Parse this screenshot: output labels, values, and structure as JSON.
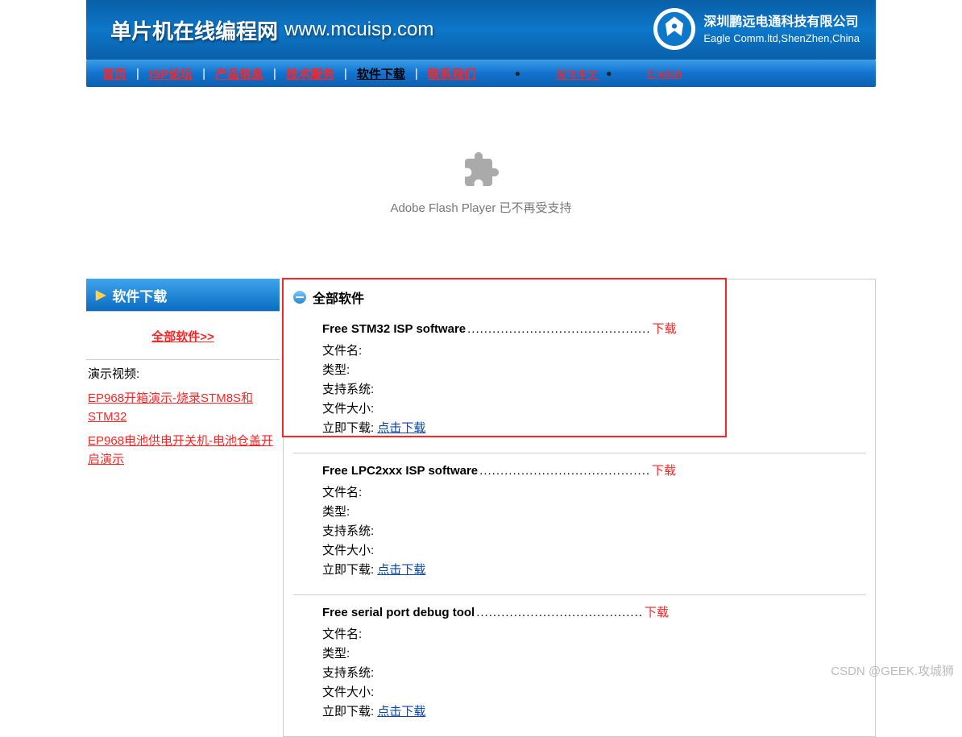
{
  "header": {
    "title_cn": "单片机在线编程网",
    "title_url": "www.mcuisp.com",
    "company_cn": "深圳鹏远电通科技有限公司",
    "company_en": "Eagle Comm.ltd,ShenZhen,China"
  },
  "nav": {
    "items": [
      {
        "label": "首页",
        "active": false
      },
      {
        "label": "ISP论坛",
        "active": false
      },
      {
        "label": "产品信息",
        "active": false
      },
      {
        "label": "技术服务",
        "active": false
      },
      {
        "label": "软件下载",
        "active": true
      },
      {
        "label": "联系我们",
        "active": false
      }
    ],
    "sep": "|",
    "lang_cn": "简体中文",
    "lang_en": "English",
    "lang_bullet": "●"
  },
  "flash": {
    "text": "Adobe Flash Player 已不再受支持"
  },
  "sidebar": {
    "header": "软件下载",
    "all_link": "全部软件>>",
    "demo_label": "演示视频:",
    "demo_links": [
      "EP968开箱演示-烧录STM8S和STM32",
      "EP968电池供电开关机-电池仓盖开启演示"
    ]
  },
  "main": {
    "section_title": "全部软件",
    "field_labels": {
      "filename": "文件名:",
      "type": "类型:",
      "os": "支持系统:",
      "size": "文件大小:",
      "download_now": "立即下载:"
    },
    "download_link_text": "点击下载",
    "badge_text": "下载",
    "software": [
      {
        "title": "Free STM32 ISP software",
        "dots": "............................................"
      },
      {
        "title": "Free LPC2xxx ISP software",
        "dots": "........................................."
      },
      {
        "title": "Free serial port debug tool",
        "dots": "........................................"
      }
    ]
  },
  "watermark": "CSDN @GEEK.攻城狮"
}
